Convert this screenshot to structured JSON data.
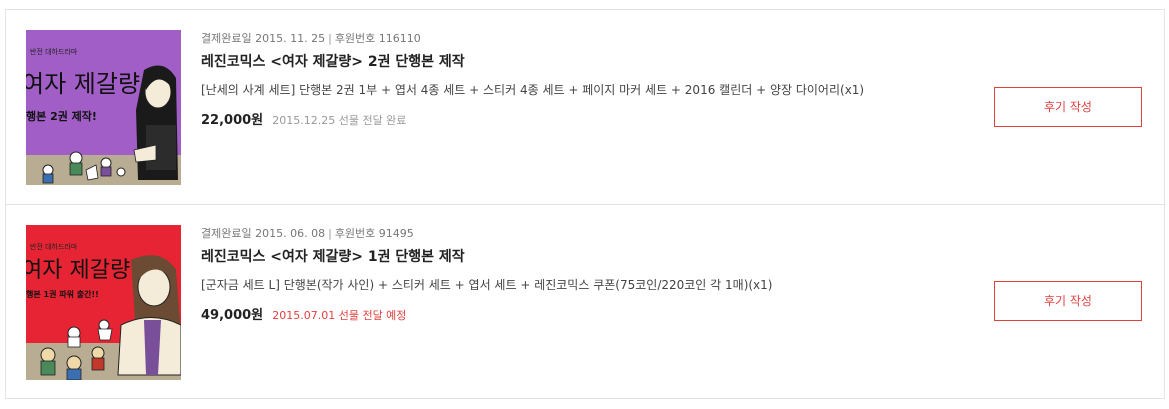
{
  "colors": {
    "accent": "#e0413f",
    "muted": "#999999",
    "border": "#e3e3e3"
  },
  "orders": [
    {
      "thumb": {
        "bg": "#a15ec6",
        "ground": "#b8ac93",
        "top_text": "반전 대하드라마",
        "title_text": "여자 제갈량",
        "sub_text": "행본 2권 제작!"
      },
      "paid_label": "결제완료일",
      "paid_date": "2015. 11. 25",
      "sep": "|",
      "sponsor_label": "후원번호",
      "sponsor_no": "116110",
      "title": "레진코믹스 <여자 제갈량> 2권 단행본 제작",
      "description": "[난세의 사계 세트] 단행본 2권 1부 + 엽서 4종 세트 + 스티커 4종 세트 + 페이지 마커 세트 + 2016 캘린더 + 양장 다이어리(x1)",
      "price": "22,000원",
      "delivery": "2015.12.25 선물 전달 완료",
      "delivery_color": "#999999",
      "button_label": "후기 작성"
    },
    {
      "thumb": {
        "bg": "#e62434",
        "ground": "#b8ac93",
        "top_text": "반전 대하드라마",
        "title_text": "여자 제갈량",
        "sub_text": "행본 1권 파워 출간!!"
      },
      "paid_label": "결제완료일",
      "paid_date": "2015. 06. 08",
      "sep": "|",
      "sponsor_label": "후원번호",
      "sponsor_no": "91495",
      "title": "레진코믹스 <여자 제갈량> 1권 단행본 제작",
      "description": "[군자금 세트 L] 단행본(작가 사인) + 스티커 세트 + 엽서 세트 + 레진코믹스 쿠폰(75코인/220코인 각 1매)(x1)",
      "price": "49,000원",
      "delivery": "2015.07.01 선물 전달 예정",
      "delivery_color": "#e0413f",
      "button_label": "후기 작성"
    }
  ]
}
